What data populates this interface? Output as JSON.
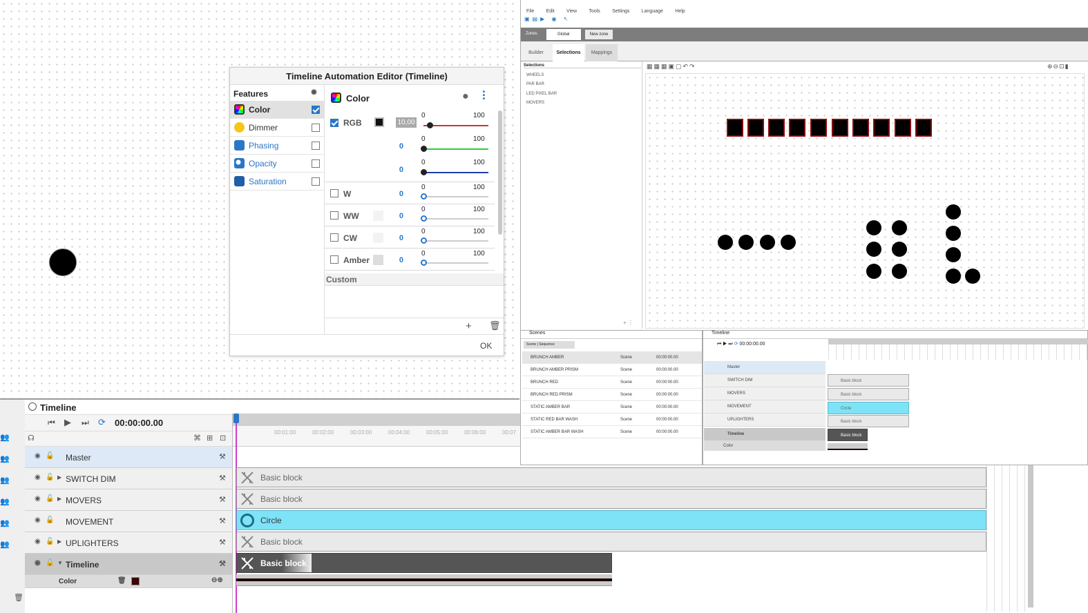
{
  "dialog": {
    "title": "Timeline Automation Editor (Timeline)",
    "features_header": "Features",
    "features": [
      {
        "label": "Color",
        "checked": true,
        "color": "#c23b2b",
        "icon": "color-wheel-icon"
      },
      {
        "label": "Dimmer",
        "checked": false,
        "color": "#f5c518",
        "icon": "sun-icon"
      },
      {
        "label": "Phasing",
        "checked": false,
        "color": "#2a76c8",
        "icon": "phasing-icon"
      },
      {
        "label": "Opacity",
        "checked": false,
        "color": "#2a76c8",
        "icon": "opacity-icon"
      },
      {
        "label": "Saturation",
        "checked": false,
        "color": "#2a76c8",
        "icon": "saturation-icon"
      }
    ],
    "panel_title": "Color",
    "rgb_label": "RGB",
    "rgb_input": "10,00",
    "rgb_values": [
      "0",
      "0"
    ],
    "tick_min": "0",
    "tick_max": "100",
    "channels": [
      {
        "label": "W",
        "value": "0"
      },
      {
        "label": "WW",
        "value": "0"
      },
      {
        "label": "CW",
        "value": "0"
      },
      {
        "label": "Amber",
        "value": "0"
      }
    ],
    "custom_label": "Custom",
    "ok_label": "OK"
  },
  "timeline": {
    "title": "Timeline",
    "time": "00:00:00.00",
    "ruler": [
      "00:01:00",
      "00:02:00",
      "00:03:00",
      "00:04:00",
      "00:05:00",
      "00:06:00",
      "00:07"
    ],
    "tracks": [
      {
        "label": "Master",
        "expandable": false
      },
      {
        "label": "SWITCH DIM",
        "expandable": true
      },
      {
        "label": "MOVERS",
        "expandable": true
      },
      {
        "label": "MOVEMENT",
        "expandable": false
      },
      {
        "label": "UPLIGHTERS",
        "expandable": true
      },
      {
        "label": "Timeline",
        "expandable": true
      }
    ],
    "blocks": [
      "Basic block",
      "Basic block",
      "Circle",
      "Basic block",
      "Basic block"
    ],
    "sub_track": "Color"
  },
  "app": {
    "menu": [
      "File",
      "Edit",
      "View",
      "Tools",
      "Settings",
      "Language",
      "Help"
    ],
    "zone_tabs": [
      "Zones",
      "Global",
      "New zone"
    ],
    "tabs": [
      "Builder",
      "Selections",
      "Mappings"
    ],
    "selections_header": "Selections",
    "selections": [
      "WHEELS",
      "PAR BAR",
      "LED PIXEL BAR",
      "MOVERS"
    ],
    "scenes_header": "Scenes",
    "scene_tabs": [
      "Scene",
      "Sequence"
    ],
    "scenes": [
      {
        "name": "BRUNCH AMBER",
        "type": "Scene",
        "time": "00:00:00.00"
      },
      {
        "name": "BRUNCH AMBER PRISM",
        "type": "Scene",
        "time": "00:00:00.00"
      },
      {
        "name": "BRUNCH RED",
        "type": "Scene",
        "time": "00:00:00.00"
      },
      {
        "name": "BRUNCH RED PRISM",
        "type": "Scene",
        "time": "00:00:00.00"
      },
      {
        "name": "STATIC AMBER BAR",
        "type": "Scene",
        "time": "00:00:00.00"
      },
      {
        "name": "STATIC RED BAR WASH",
        "type": "Scene",
        "time": "00:00:00.00"
      },
      {
        "name": "STATIC AMBER BAR WASH",
        "type": "Scene",
        "time": "00:00:00.00"
      }
    ],
    "mini_timeline": {
      "title": "Timeline",
      "time": "00:00:00.00",
      "tracks": [
        "Master",
        "SWITCH DIM",
        "MOVERS",
        "MOVEMENT",
        "UPLIGHTERS",
        "Timeline"
      ],
      "blocks": [
        "Basic block",
        "Basic block",
        "Circle",
        "Basic block",
        "Basic block"
      ],
      "sub_track": "Color"
    }
  },
  "colors": {
    "accent": "#2a76c8",
    "circle_block": "#7ee3f7",
    "selected_row": "#dde9f7",
    "playhead": "#d23bd2"
  }
}
